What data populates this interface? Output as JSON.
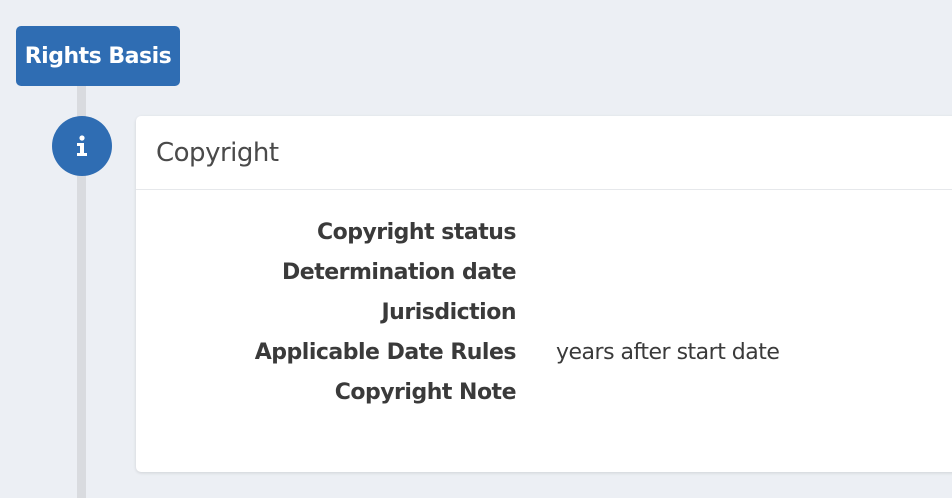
{
  "rights_basis": {
    "label": "Rights Basis"
  },
  "card": {
    "title": "Copyright",
    "fields": [
      {
        "label": "Copyright status",
        "value": ""
      },
      {
        "label": "Determination date",
        "value": ""
      },
      {
        "label": "Jurisdiction",
        "value": ""
      },
      {
        "label": "Applicable Date Rules",
        "value": "years after start date"
      },
      {
        "label": "Copyright Note",
        "value": ""
      }
    ]
  },
  "colors": {
    "accent": "#2f6db3",
    "background": "#eceff4",
    "timeline": "#d9dbdf"
  },
  "icons": {
    "badge": "info-icon"
  }
}
